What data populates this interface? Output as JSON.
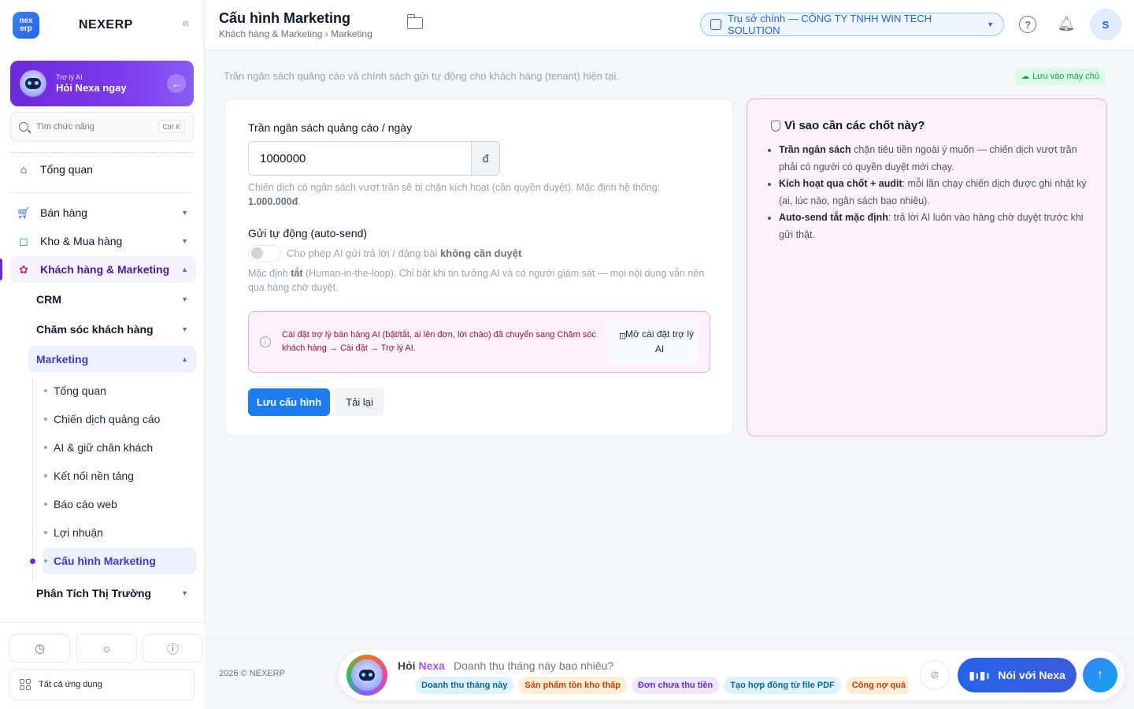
{
  "brand": {
    "logo_text_top": "nex",
    "logo_text_bottom": "erp",
    "name": "NEXERP",
    "collapse_glyph": "«"
  },
  "ai_assistant": {
    "small_label": "Trợ lý AI",
    "title": "Hỏi Nexa ngay"
  },
  "search": {
    "placeholder": "Tìm chức năng",
    "shortcut": "Ctrl K"
  },
  "sidebar": {
    "overview": "Tổng quan",
    "groups": [
      {
        "label": "Bán hàng",
        "icon": "cart-icon"
      },
      {
        "label": "Kho & Mua hàng",
        "icon": "bag-icon"
      },
      {
        "label": "Khách hàng & Marketing",
        "icon": "users-icon"
      }
    ],
    "sub_groups": [
      {
        "label": "CRM"
      },
      {
        "label": "Chăm sóc khách hàng"
      },
      {
        "label": "Marketing"
      }
    ],
    "leaves": [
      "Tổng quan",
      "Chiến dịch quảng cáo",
      "AI & giữ chân khách",
      "Kết nối nền tảng",
      "Báo cáo web",
      "Lợi nhuận",
      "Cấu hình Marketing"
    ],
    "market_analysis": "Phân Tích Thị Trường",
    "all_apps": "Tất cả ứng dụng"
  },
  "header": {
    "title": "Cấu hình Marketing",
    "breadcrumb": "Khách hàng & Marketing › Marketing",
    "tenant": "Trụ sở chính — CÔNG TY TNHH WIN TECH SOLUTION",
    "help": "?",
    "avatar": "S"
  },
  "main": {
    "intro": "Trần ngân sách quảng cáo và chính sách gửi tự động cho khách hàng (tenant) hiện tại.",
    "save_badge": "Lưu vào máy chủ",
    "budget_label": "Trần ngân sách quảng cáo / ngày",
    "budget_value": "1000000",
    "budget_unit": "đ",
    "budget_help": "Chiến dịch có ngân sách vượt trần sẽ bị chặn kích hoạt (cần quyền duyệt). Mặc định hệ thống:",
    "budget_default": "1.000.000đ",
    "autosend_label": "Gửi tự động (auto-send)",
    "autosend_toggle_text": "Cho phép AI gửi trả lời / đăng bài",
    "autosend_toggle_bold": "không cần duyệt",
    "autosend_help_pre": "Mặc định",
    "autosend_help_bold": "tắt",
    "autosend_help_post": "(Human-in-the-loop). Chỉ bật khi tin tưởng AI và có người giám sát — mọi nội dung vẫn nên qua hàng chờ duyệt.",
    "notice_text": "Cài đặt trợ lý bán hàng AI (bật/tắt, ai lên đơn, lời chào) đã chuyển sang Chăm sóc khách hàng → Cài đặt → Trợ lý AI.",
    "notice_button": "Mở cài đặt trợ lý AI",
    "save_button": "Lưu cấu hình",
    "reload_button": "Tải lại"
  },
  "why": {
    "title": "Vì sao cần các chốt này?",
    "items": [
      {
        "bold": "Trần ngân sách",
        "text": " chặn tiêu tiền ngoài ý muốn — chiến dịch vượt trần phải có người có quyền duyệt mới chạy."
      },
      {
        "bold": "Kích hoạt qua chốt + audit",
        "text": ": mỗi lần chạy chiến dịch được ghi nhật ký (ai, lúc nào, ngân sách bao nhiêu)."
      },
      {
        "bold": "Auto-send tắt mặc định",
        "text": ": trả lời AI luôn vào hàng chờ duyệt trước khi gửi thật."
      }
    ]
  },
  "footer": {
    "copyright": "2026 © NEXERP",
    "ask_prefix": "Hỏi",
    "ask_name": "Nexa",
    "ask_placeholder": "Doanh thu tháng này bao nhiêu?",
    "chips": [
      {
        "label": "Doanh thu tháng này",
        "bg": "#e0f2fe",
        "fg": "#0369a1"
      },
      {
        "label": "Sản phẩm tồn kho thấp",
        "bg": "#ffedd5",
        "fg": "#c2410c"
      },
      {
        "label": "Đơn chưa thu tiền",
        "bg": "#ede9fe",
        "fg": "#6d28d9"
      },
      {
        "label": "Tạo hợp đồng từ file PDF",
        "bg": "#e0f2fe",
        "fg": "#0369a1"
      },
      {
        "label": "Công nợ quá hạn",
        "bg": "#ffedd5",
        "fg": "#c2410c"
      }
    ],
    "talk_button": "Nói với Nexa"
  }
}
